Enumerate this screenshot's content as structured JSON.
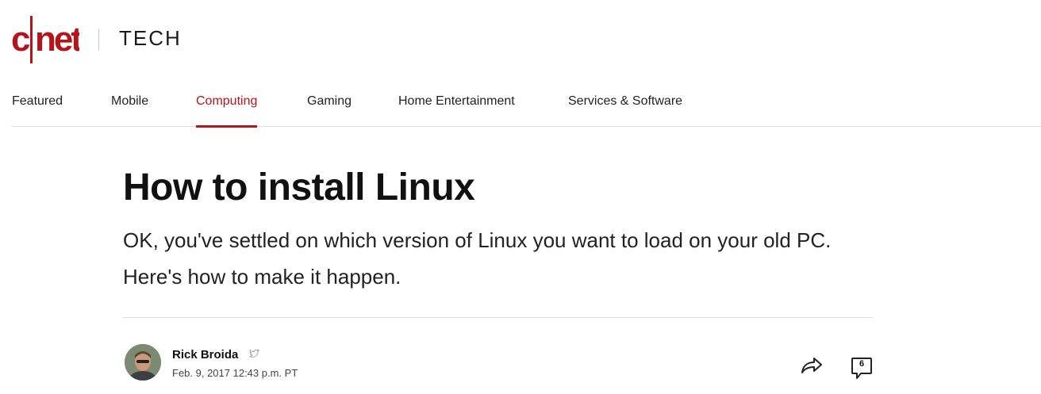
{
  "brand": {
    "logo_text": "c|net",
    "section": "TECH",
    "brand_color": "#b4151a"
  },
  "nav": {
    "items": [
      {
        "label": "Featured",
        "active": false
      },
      {
        "label": "Mobile",
        "active": false
      },
      {
        "label": "Computing",
        "active": true
      },
      {
        "label": "Gaming",
        "active": false
      },
      {
        "label": "Home Entertainment",
        "active": false
      },
      {
        "label": "Services & Software",
        "active": false
      }
    ]
  },
  "article": {
    "headline": "How to install Linux",
    "dek": "OK, you've settled on which version of Linux you want to load on your old PC. Here's how to make it happen.",
    "author": "Rick Broida",
    "author_social_icon": "twitter-icon",
    "date": "Feb. 9, 2017 12:43 p.m. PT"
  },
  "actions": {
    "share_icon": "share-icon",
    "comment_icon": "comment-icon",
    "comment_count": "6"
  }
}
